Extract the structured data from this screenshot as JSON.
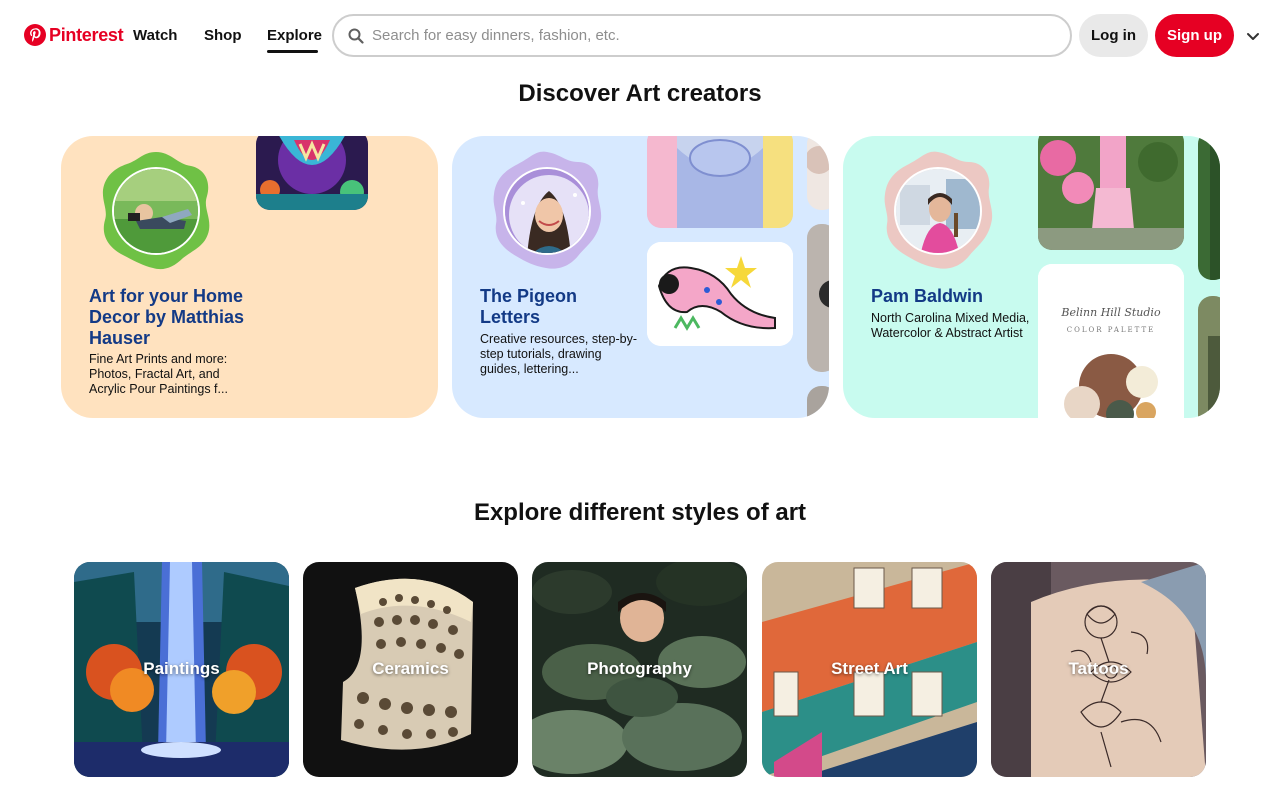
{
  "brand": {
    "name": "Pinterest",
    "color": "#e60023",
    "icon": "pinterest-logo-icon"
  },
  "nav": {
    "links": [
      {
        "label": "Watch"
      },
      {
        "label": "Shop"
      },
      {
        "label": "Explore",
        "active": true
      }
    ]
  },
  "search": {
    "placeholder": "Search for easy dinners, fashion, etc.",
    "value": "",
    "icon": "search-icon"
  },
  "auth": {
    "login_label": "Log in",
    "signup_label": "Sign up",
    "menu_icon": "chevron-down-icon"
  },
  "creators": {
    "title": "Discover Art creators",
    "cards": [
      {
        "name": "Art for your Home Decor by Matthias Hauser",
        "description": "Fine Art Prints and more: Photos, Fractal Art, and Acrylic Pour Paintings f...",
        "background": "#ffe2bf",
        "blob_color": "#6fc145"
      },
      {
        "name": "The Pigeon Letters",
        "description": "Creative resources, step-by-step tutorials, drawing guides, lettering...",
        "background": "#d7e9ff",
        "blob_color": "#b9a7e0"
      },
      {
        "name": "Pam Baldwin",
        "description": "North Carolina Mixed Media, Watercolor & Abstract Artist",
        "background": "#c8fbef",
        "blob_color": "#ecc8c3"
      }
    ],
    "palette_card": {
      "script_text": "Belinn Hill Studio",
      "caption": "COLOR PALETTE"
    }
  },
  "styles": {
    "title": "Explore different styles of art",
    "tiles": [
      {
        "label": "Paintings"
      },
      {
        "label": "Ceramics"
      },
      {
        "label": "Photography"
      },
      {
        "label": "Street Art"
      },
      {
        "label": "Tattoos"
      }
    ]
  }
}
